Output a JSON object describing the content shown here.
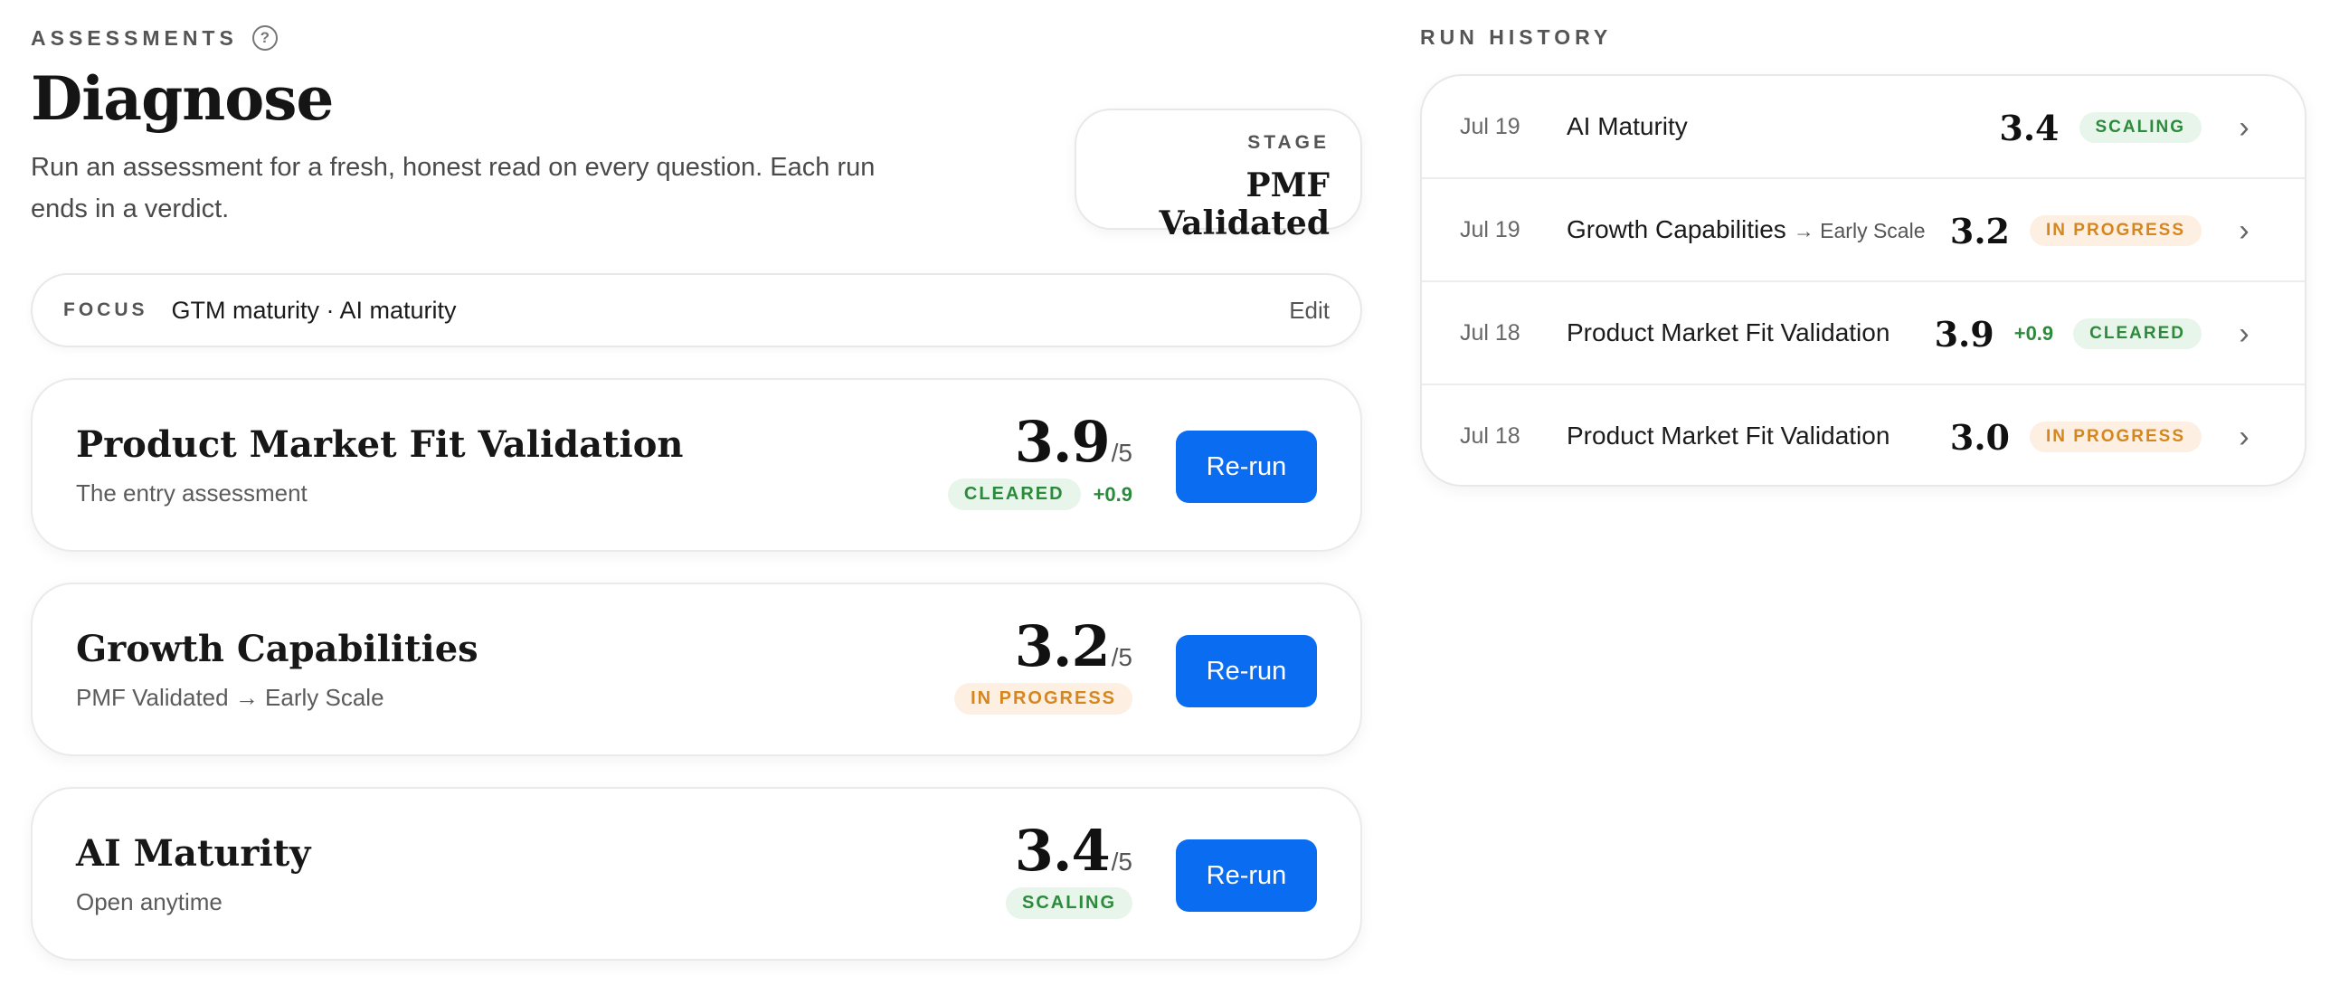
{
  "header": {
    "eyebrow": "ASSESSMENTS",
    "title": "Diagnose",
    "subtitle": "Run an assessment for a fresh, honest read on every question. Each run ends in a verdict."
  },
  "stage": {
    "label": "STAGE",
    "value": "PMF Validated"
  },
  "focus": {
    "label": "FOCUS",
    "value": "GTM maturity · AI maturity",
    "edit_label": "Edit"
  },
  "assessments": [
    {
      "title": "Product Market Fit Validation",
      "subtitle": "The entry assessment",
      "score": "3.9",
      "scale": "/5",
      "status": "CLEARED",
      "status_color": "#2c8a3c",
      "delta": "+0.9",
      "button": "Re-run"
    },
    {
      "title": "Growth Capabilities",
      "subtitle": "PMF Validated → Early Scale",
      "score": "3.2",
      "scale": "/5",
      "status": "IN PROGRESS",
      "status_color": "#d6861f",
      "delta": "",
      "button": "Re-run"
    },
    {
      "title": "AI Maturity",
      "subtitle": "Open anytime",
      "score": "3.4",
      "scale": "/5",
      "status": "SCALING",
      "status_color": "#2c8a3c",
      "delta": "",
      "button": "Re-run"
    }
  ],
  "history": {
    "label": "RUN HISTORY",
    "rows": [
      {
        "date": "Jul 19",
        "name": "AI Maturity",
        "sub": "",
        "score": "3.4",
        "delta": "",
        "status": "SCALING"
      },
      {
        "date": "Jul 19",
        "name": "Growth Capabilities",
        "sub": "→ Early Scale",
        "score": "3.2",
        "delta": "",
        "status": "IN PROGRESS"
      },
      {
        "date": "Jul 18",
        "name": "Product Market Fit Validation",
        "sub": "",
        "score": "3.9",
        "delta": "+0.9",
        "status": "CLEARED"
      },
      {
        "date": "Jul 18",
        "name": "Product Market Fit Validation",
        "sub": "",
        "score": "3.0",
        "delta": "",
        "status": "IN PROGRESS"
      }
    ]
  },
  "icons": {
    "help": "help-circle-icon",
    "chevron": "chevron-right-icon"
  },
  "colors": {
    "accent": "#0a6cf0",
    "green": "#2c8a3c",
    "orange": "#d6861f"
  }
}
